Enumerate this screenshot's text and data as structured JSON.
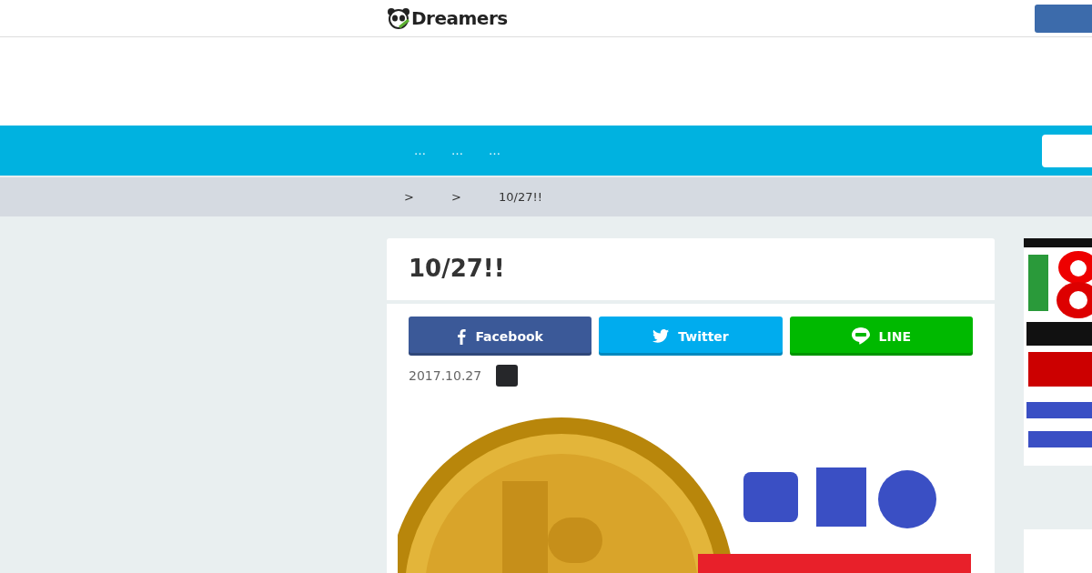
{
  "header": {
    "logo": "Dreamers"
  },
  "nav": {
    "items": [
      "…",
      "…",
      "…"
    ]
  },
  "breadcrumb": [
    {
      "kind": "separator",
      "text": ">"
    },
    {
      "kind": "separator",
      "text": ">"
    },
    {
      "kind": "current",
      "text": "10/27!!"
    }
  ],
  "article": {
    "title": "10/27!!",
    "share_buttons": [
      {
        "kind": "facebook",
        "label": "Facebook",
        "color": "#3b5998"
      },
      {
        "kind": "twitter",
        "label": "Twitter",
        "color": "#00acee"
      },
      {
        "kind": "line",
        "label": "LINE",
        "color": "#00b900"
      }
    ],
    "date": "2017.10.27"
  }
}
